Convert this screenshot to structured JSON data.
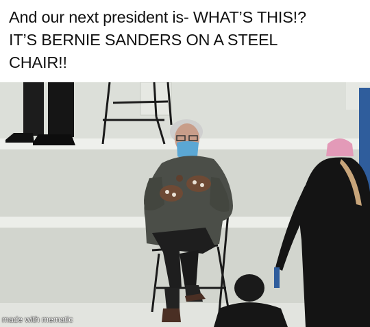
{
  "caption": {
    "lines": [
      "And our next president is-  WHAT’S THIS!?",
      "IT’S BERNIE SANDERS ON A STEEL",
      "CHAIR!!"
    ]
  },
  "watermark": {
    "text": "made with mematic"
  },
  "colors": {
    "steps": "#d9dcd6",
    "step_edge": "#eef0ec",
    "jacket": "#4b4e48",
    "mask": "#5ba7d4",
    "hat": "#e39ab8",
    "chair": "#1a1a1a",
    "blue_rail": "#2f5d9c"
  },
  "photo": {
    "icons": [
      "meme-photo"
    ]
  }
}
